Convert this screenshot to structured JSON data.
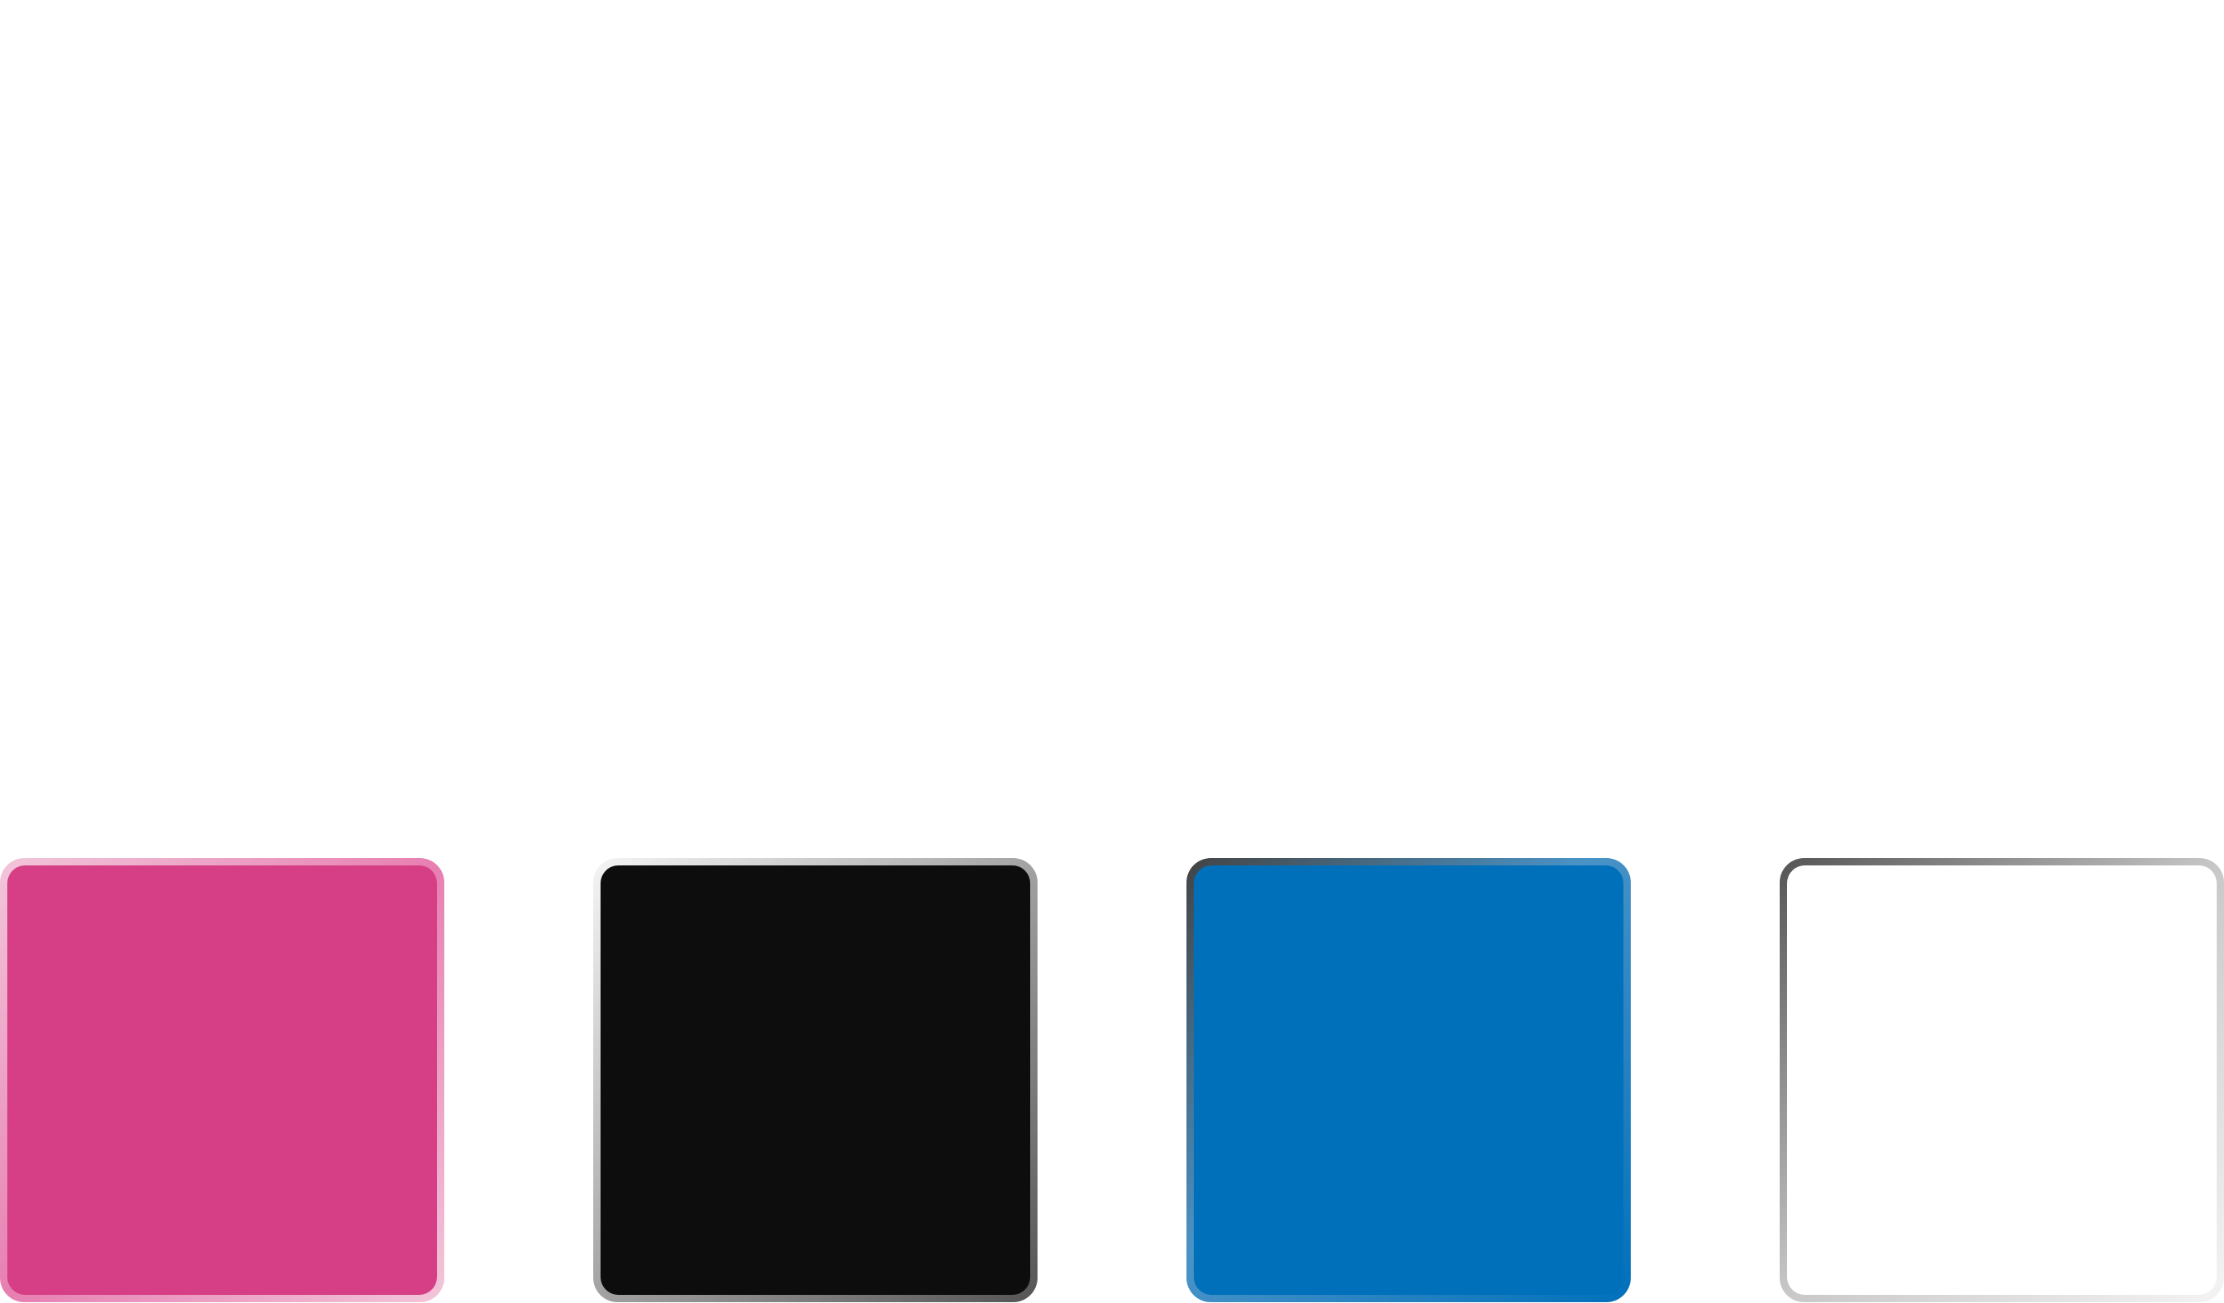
{
  "swatches": [
    {
      "name": "pink",
      "fill": "#d63f85",
      "border_light": "#f2c6da",
      "border_dark": "#e77fb1"
    },
    {
      "name": "black",
      "fill": "#0d0d0d",
      "border_light": "#f5f5f5",
      "border_dark": "#555555"
    },
    {
      "name": "blue",
      "fill": "#0070bb",
      "border_light": "#4a93c7",
      "border_dark": "#444444"
    },
    {
      "name": "white",
      "fill": "#ffffff",
      "border_light": "#f4f4f4",
      "border_dark": "#555555"
    }
  ]
}
